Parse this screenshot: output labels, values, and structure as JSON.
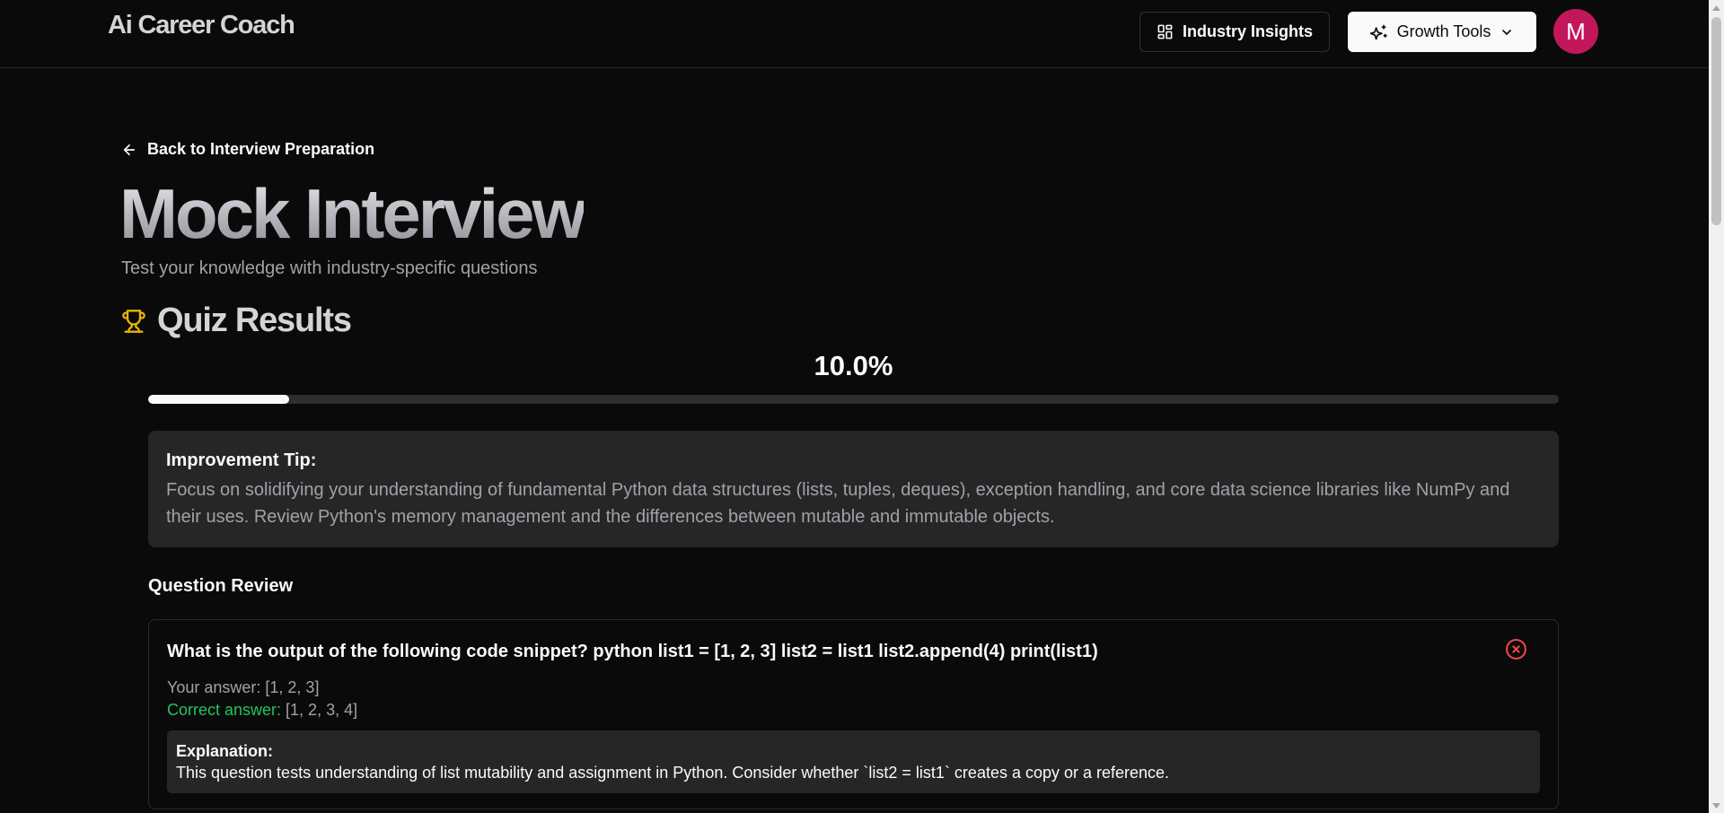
{
  "header": {
    "logo": "Ai Career Coach",
    "insights_label": "Industry Insights",
    "growth_label": "Growth Tools",
    "avatar_initial": "M"
  },
  "main": {
    "back_label": "Back to Interview Preparation",
    "title": "Mock Interview",
    "subtitle": "Test your knowledge with industry-specific questions",
    "results_heading": "Quiz Results",
    "score_text": "10.0%",
    "score_fraction": 0.1,
    "tip": {
      "title": "Improvement Tip:",
      "body": "Focus on solidifying your understanding of fundamental Python data structures (lists, tuples, deques), exception handling, and core data science libraries like NumPy and their uses. Review Python's memory management and the differences between mutable and immutable objects."
    },
    "review_heading": "Question Review",
    "questions": [
      {
        "question": "What is the output of the following code snippet? python list1 = [1, 2, 3] list2 = list1 list2.append(4) print(list1)",
        "your_answer_label": "Your answer:",
        "your_answer": " [1, 2, 3]",
        "correct_answer_label": "Correct answer:",
        "correct_answer": " [1, 2, 3, 4]",
        "explanation_title": "Explanation:",
        "explanation": "This question tests understanding of list mutability and assignment in Python. Consider whether `list2 = list1` creates a copy or a reference.",
        "status_icon": "x-circle-icon"
      }
    ]
  },
  "colors": {
    "background": "#0a0a0a",
    "card": "#262626",
    "accent_trophy": "#eab308",
    "correct": "#22c55e",
    "incorrect": "#ef4444",
    "avatar": "#c2185b"
  }
}
